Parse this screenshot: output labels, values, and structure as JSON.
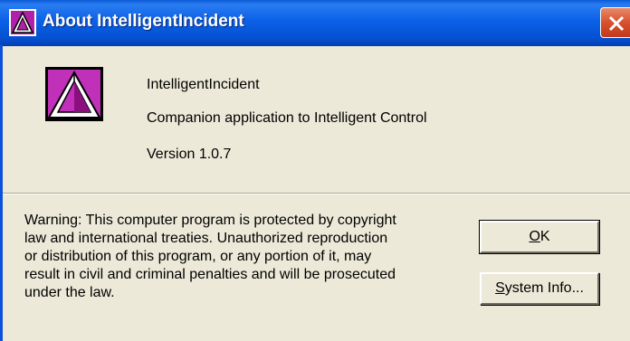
{
  "window": {
    "title": "About IntelligentIncident",
    "app_icon": "intelligent-a-logo",
    "close_icon": "close-x-icon"
  },
  "info": {
    "app_name": "IntelligentIncident",
    "description": "Companion application to Intelligent Control",
    "version": "Version 1.0.7"
  },
  "warning_lines": [
    "Warning: This computer program is protected by copyright",
    "law and international treaties. Unauthorized reproduction",
    "or distribution of this program, or any portion of it, may",
    "result in civil and criminal penalties and will be prosecuted",
    "under the law."
  ],
  "buttons": {
    "ok_accel": "O",
    "ok_rest": "K",
    "sysinfo_accel": "S",
    "sysinfo_rest": "ystem Info..."
  },
  "colors": {
    "titlebar": "#0c61e8",
    "close": "#d6512f",
    "dialog_bg": "#ece9d8",
    "logo_magenta": "#b020a8"
  }
}
